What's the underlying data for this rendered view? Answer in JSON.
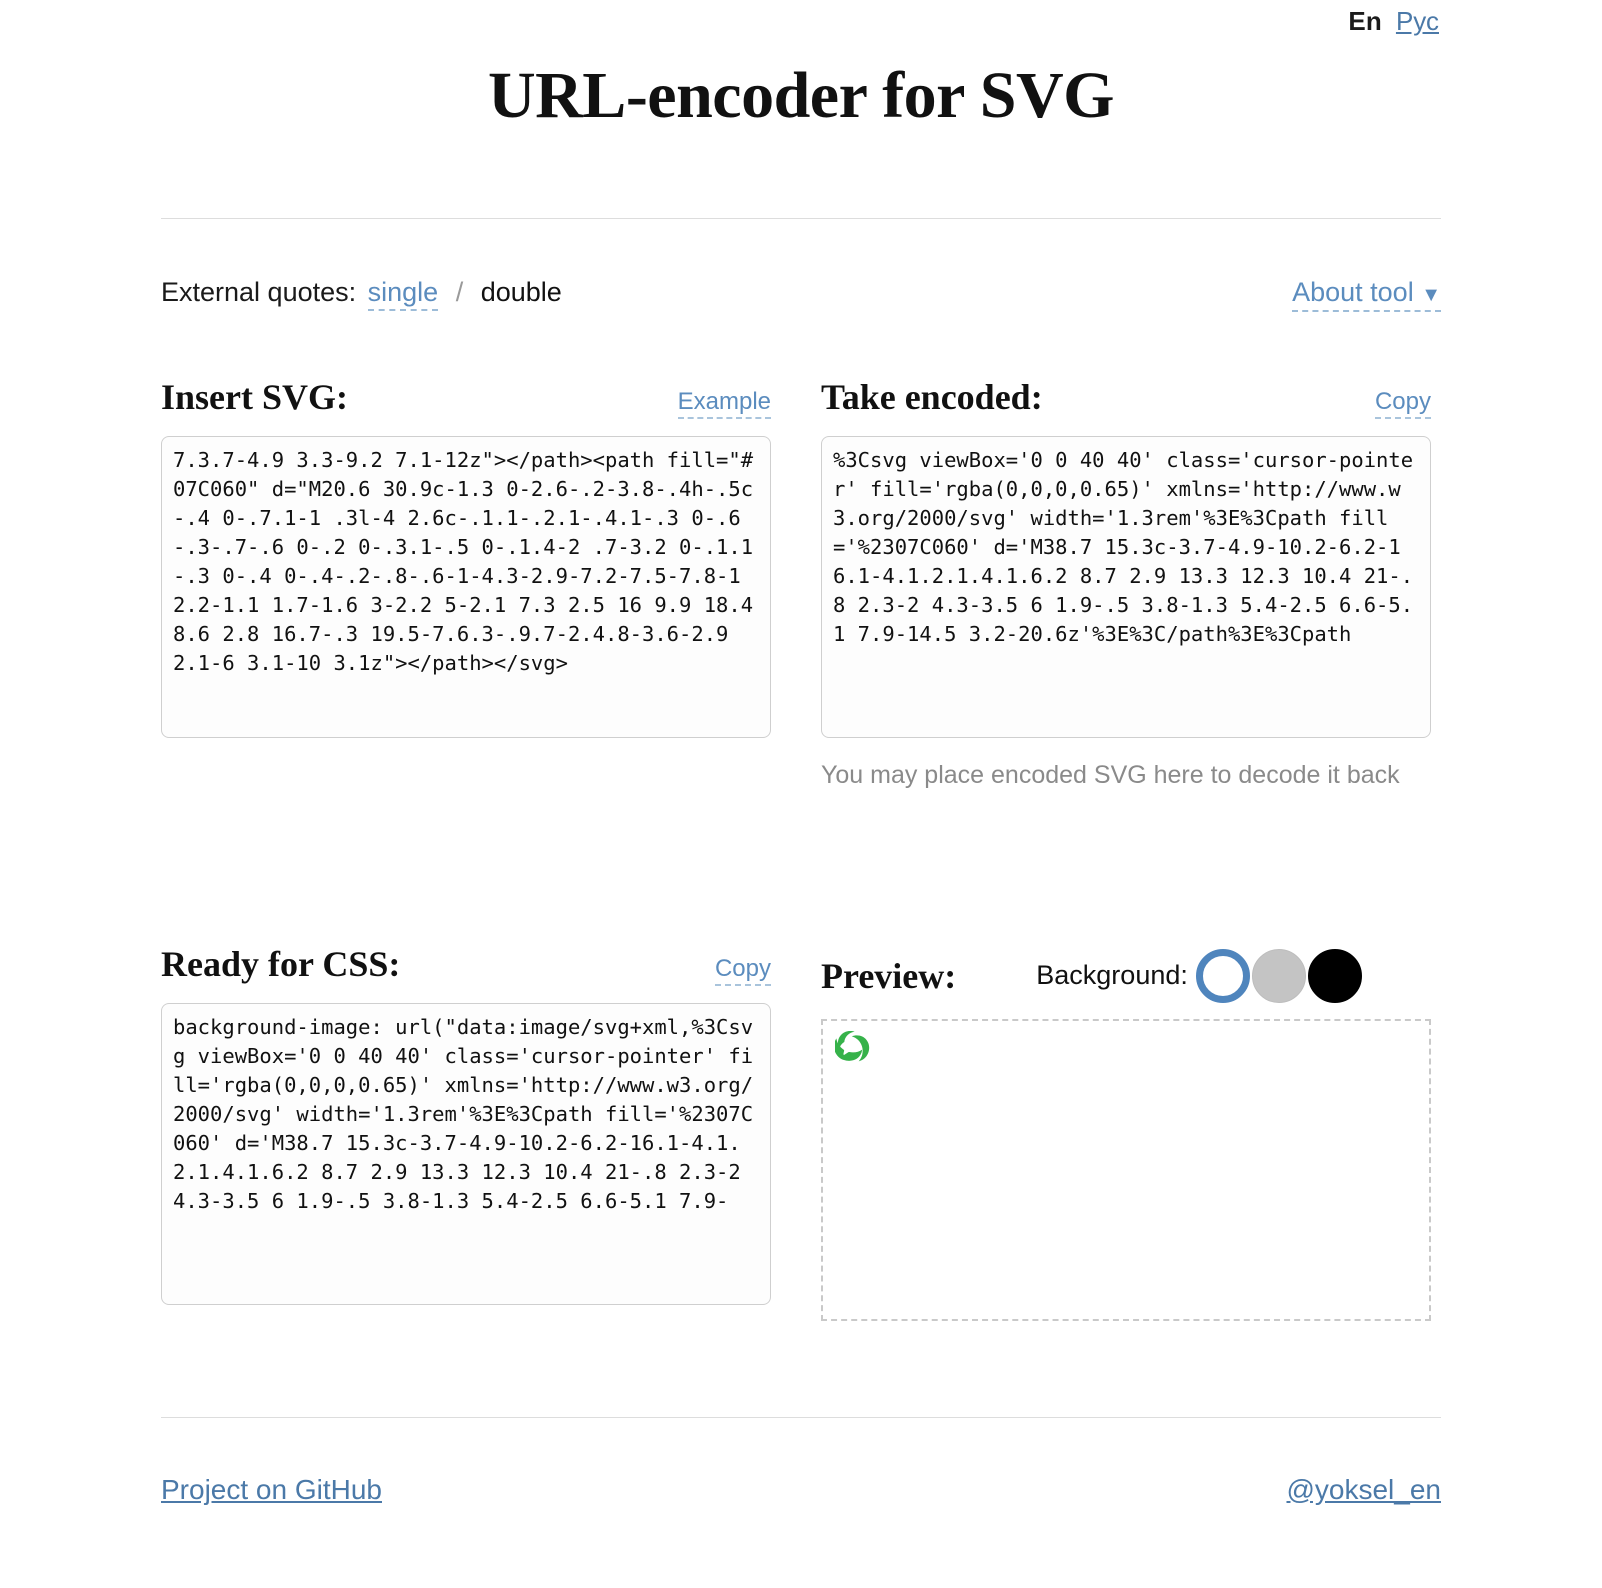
{
  "lang": {
    "current": "En",
    "alternate": "Рус"
  },
  "header": {
    "title": "URL-encoder for SVG"
  },
  "controls": {
    "quotes_label": "External quotes:",
    "quote_single": "single",
    "quote_separator": "/",
    "quote_double": "double",
    "about_tool": "About tool",
    "about_caret": "▼"
  },
  "panels": {
    "insert": {
      "title": "Insert SVG:",
      "action": "Example",
      "value": "7.3.7-4.9 3.3-9.2 7.1-12z\"></path><path fill=\"#07C060\" d=\"M20.6 30.9c-1.3 0-2.6-.2-3.8-.4h-.5c-.4 0-.7.1-1 .3l-4 2.6c-.1.1-.2.1-.4.1-.3 0-.6-.3-.7-.6 0-.2 0-.3.1-.5 0-.1.4-2 .7-3.2 0-.1.1-.3 0-.4 0-.4-.2-.8-.6-1-4.3-2.9-7.2-7.5-7.8-12.2-1.1 1.7-1.6 3-2.2 5-2.1 7.3 2.5 16 9.9 18.4 8.6 2.8 16.7-.3 19.5-7.6.3-.9.7-2.4.8-3.6-2.9 2.1-6 3.1-10 3.1z\"></path></svg>"
    },
    "encoded": {
      "title": "Take encoded:",
      "action": "Copy",
      "value": "%3Csvg viewBox='0 0 40 40' class='cursor-pointer' fill='rgba(0,0,0,0.65)' xmlns='http://www.w3.org/2000/svg' width='1.3rem'%3E%3Cpath fill='%2307C060' d='M38.7 15.3c-3.7-4.9-10.2-6.2-16.1-4.1.2.1.4.1.6.2 8.7 2.9 13.3 12.3 10.4 21-.8 2.3-2 4.3-3.5 6 1.9-.5 3.8-1.3 5.4-2.5 6.6-5.1 7.9-14.5 3.2-20.6z'%3E%3C/path%3E%3Cpath",
      "hint": "You may place encoded SVG here to decode it back"
    },
    "css": {
      "title": "Ready for CSS:",
      "action": "Copy",
      "value": "background-image: url(\"data:image/svg+xml,%3Csvg viewBox='0 0 40 40' class='cursor-pointer' fill='rgba(0,0,0,0.65)' xmlns='http://www.w3.org/2000/svg' width='1.3rem'%3E%3Cpath fill='%2307C060' d='M38.7 15.3c-3.7-4.9-10.2-6.2-16.1-4.1.2.1.4.1.6.2 8.7 2.9 13.3 12.3 10.4 21-.8 2.3-2 4.3-3.5 6 1.9-.5 3.8-1.3 5.4-2.5 6.6-5.1 7.9-"
    },
    "preview": {
      "title": "Preview:",
      "background_label": "Background:",
      "swatches": [
        {
          "name": "white",
          "color": "#ffffff",
          "selected": true
        },
        {
          "name": "gray",
          "color": "#c4c4c4",
          "selected": false
        },
        {
          "name": "black",
          "color": "#000000",
          "selected": false
        }
      ],
      "icon_color": "#36B24A"
    }
  },
  "footer": {
    "github": "Project on GitHub",
    "author": "@yoksel_en"
  },
  "colors": {
    "link": "#5b8cbe",
    "accent_green": "#07C060",
    "selected_ring": "#4f85bd"
  }
}
